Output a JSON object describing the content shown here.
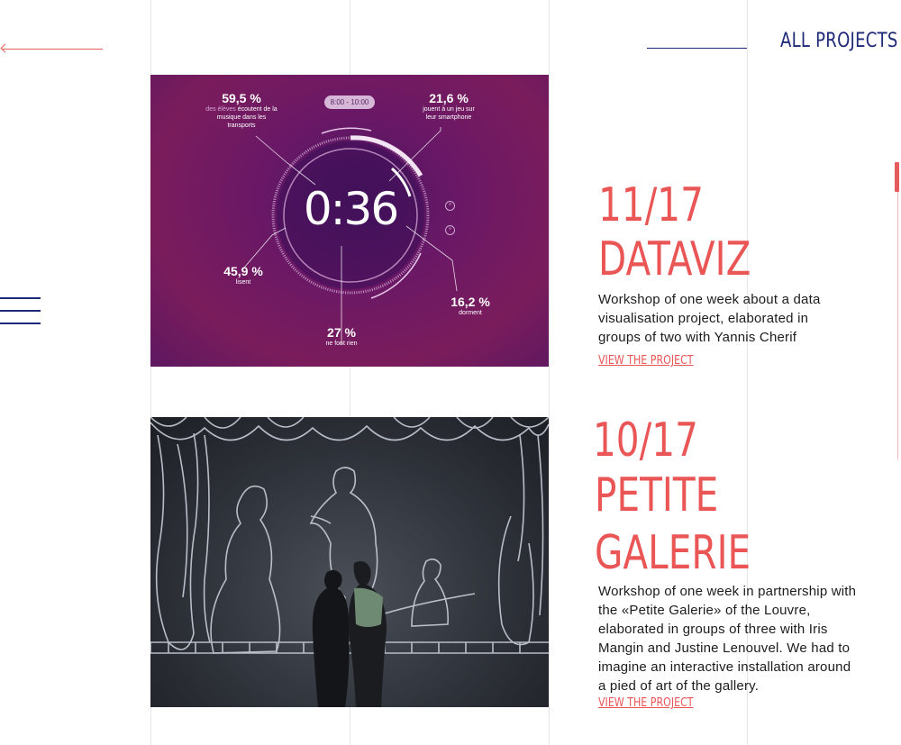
{
  "header": {
    "all_projects_label": "ALL PROJECTS"
  },
  "colors": {
    "accent": "#ea5555",
    "navy": "#1e2a78"
  },
  "projects": [
    {
      "number": "11/17",
      "title": "DATAVIZ",
      "description": "Workshop of one week about a data visualisation project, elaborated in groups of two with Yannis Cherif",
      "link_label": "VIEW THE PROJECT",
      "image": {
        "time_range": "8:00 - 10:00",
        "timer": "0:36",
        "stats": [
          {
            "pct": "59,5 %",
            "caption_hl": "des élèves",
            "caption": " écoutent de la musique dans les transports"
          },
          {
            "pct": "21,6 %",
            "caption": "jouent à un jeu sur leur smartphone"
          },
          {
            "pct": "45,9 %",
            "caption": "lisent"
          },
          {
            "pct": "16,2 %",
            "caption": "dorment"
          },
          {
            "pct": "27 %",
            "caption": "ne font rien"
          }
        ]
      }
    },
    {
      "number": "10/17",
      "title_line1": "PETITE",
      "title_line2": "GALERIE",
      "description": "Workshop of one week in partnership with the «Petite Galerie» of the Louvre, elaborated in groups of three with Iris Mangin and Justine Lenouvel. We had to imagine an interactive installation around a pied of art of the gallery.",
      "link_label": "VIEW THE PROJECT"
    }
  ]
}
